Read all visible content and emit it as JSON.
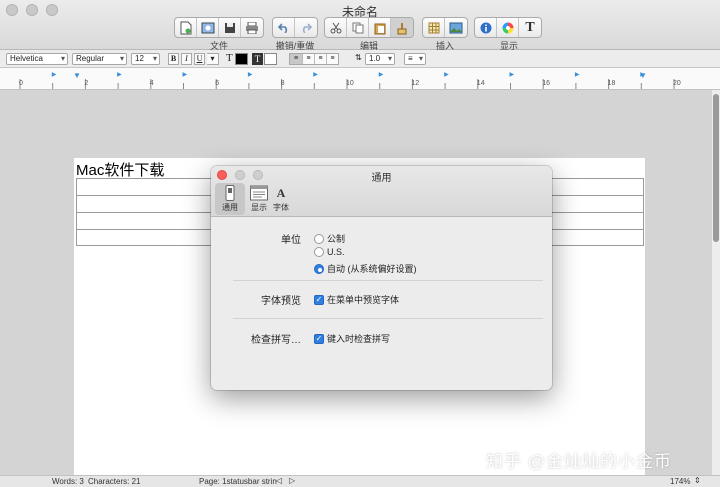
{
  "window": {
    "title": "未命名"
  },
  "toolbar": {
    "groups": [
      {
        "label": "文件",
        "icons": [
          "new-document-icon",
          "image-icon",
          "save-icon",
          "print-icon"
        ]
      },
      {
        "label": "撤销/重做",
        "icons": [
          "undo-icon",
          "redo-icon"
        ]
      },
      {
        "label": "编辑",
        "icons": [
          "cut-icon",
          "copy-icon",
          "paste-icon",
          "paste-style-icon"
        ]
      },
      {
        "label": "插入",
        "icons": [
          "table-icon",
          "picture-icon"
        ]
      },
      {
        "label": "显示",
        "icons": [
          "info-icon",
          "color-wheel-icon",
          "font-icon"
        ]
      }
    ]
  },
  "format_bar": {
    "font_family": "Helvetica",
    "font_style": "Regular",
    "font_size": "12",
    "bold": "B",
    "italic": "I",
    "underline": "U",
    "line_spacing": "1.0",
    "text_color": "#000000",
    "highlight_color": "#ffffff"
  },
  "ruler": {
    "ticks": [
      "0",
      "2",
      "4",
      "6",
      "8",
      "10",
      "12",
      "14",
      "16",
      "18",
      "20"
    ]
  },
  "document": {
    "heading": "Mac软件下载",
    "table_rows": 4
  },
  "status_bar": {
    "words": "Words: 3",
    "characters": "Characters: 21",
    "page": "Page: 1statusbar strin",
    "zoom": "174%"
  },
  "preferences": {
    "title": "通用",
    "tabs": [
      {
        "label": "通用",
        "icon": "switch-icon",
        "active": true
      },
      {
        "label": "显示",
        "icon": "display-icon",
        "active": false
      },
      {
        "label": "字体",
        "icon": "font-icon",
        "active": false
      }
    ],
    "units": {
      "label": "单位",
      "options": [
        {
          "label": "公制",
          "selected": false
        },
        {
          "label": "U.S.",
          "selected": false
        },
        {
          "label": "自动 (从系统偏好设置)",
          "selected": true
        }
      ]
    },
    "font_preview": {
      "label": "字体预览",
      "option": "在菜单中预览字体",
      "checked": true
    },
    "spell_check": {
      "label": "检查拼写…",
      "option": "键入时检查拼写",
      "checked": true
    }
  },
  "watermark": "知乎 @金灿灿的小金币",
  "colors": {
    "accent": "#2f7fe0",
    "close": "#fc5f57"
  }
}
